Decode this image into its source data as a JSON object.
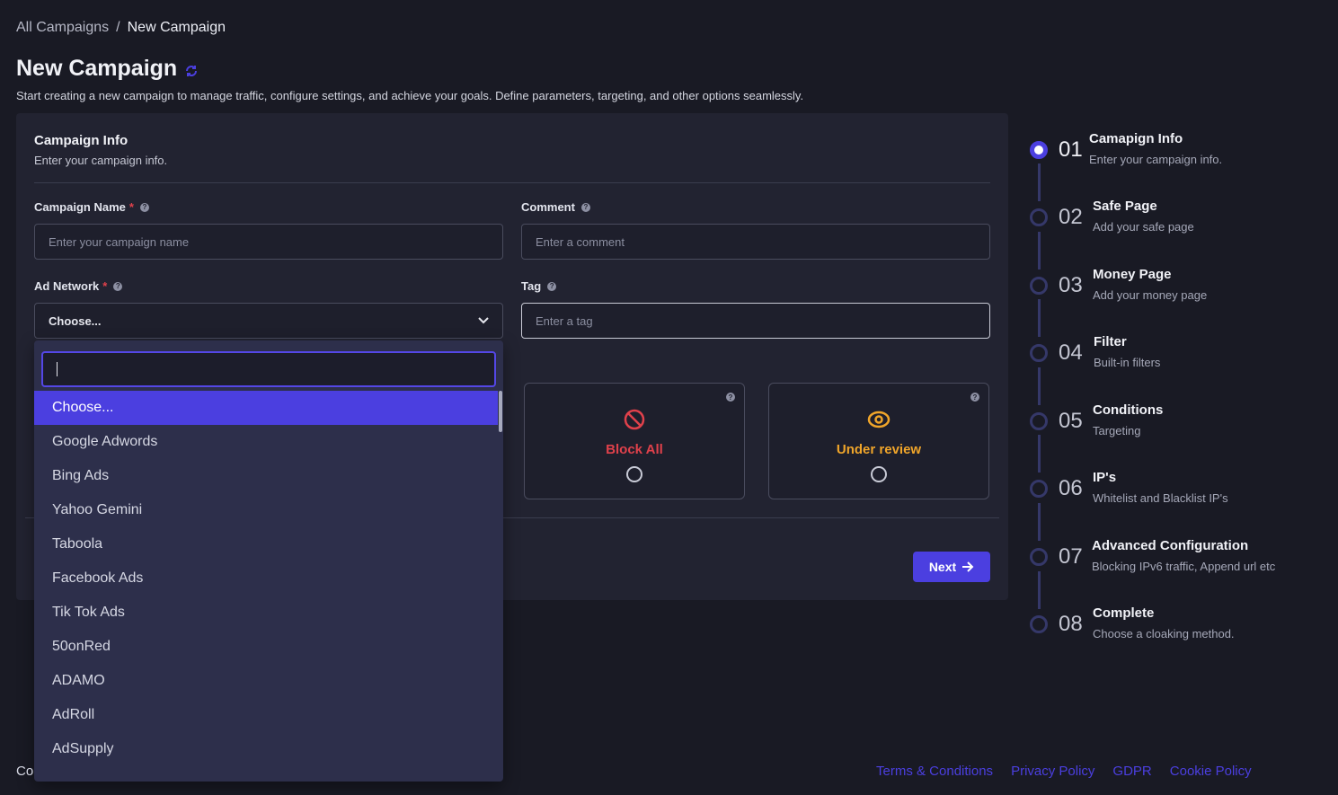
{
  "breadcrumb": {
    "parent": "All Campaigns",
    "separator": "/",
    "current": "New Campaign"
  },
  "page": {
    "title": "New Campaign",
    "subtitle": "Start creating a new campaign to manage traffic, configure settings, and achieve your goals. Define parameters, targeting, and other options seamlessly."
  },
  "card": {
    "section_title": "Campaign Info",
    "section_sub": "Enter your campaign info.",
    "campaign_name_label": "Campaign Name",
    "campaign_name_placeholder": "Enter your campaign name",
    "comment_label": "Comment",
    "comment_placeholder": "Enter a comment",
    "ad_network_label": "Ad Network",
    "ad_network_value": "Choose...",
    "tag_label": "Tag",
    "tag_placeholder": "Enter a tag",
    "required_mark": "*",
    "options": [
      {
        "label": "Block All",
        "color": "#e0414b",
        "icon": "block-icon"
      },
      {
        "label": "Under review",
        "color": "#f0a52a",
        "icon": "eye-icon"
      }
    ],
    "next_label": "Next"
  },
  "dropdown": {
    "search_value": "",
    "items": [
      "Choose...",
      "Google Adwords",
      "Bing Ads",
      "Yahoo Gemini",
      "Taboola",
      "Facebook Ads",
      "Tik Tok Ads",
      "50onRed",
      "ADAMO",
      "AdRoll",
      "AdSupply"
    ]
  },
  "steps": [
    {
      "num": "01",
      "title": "Camapign Info",
      "sub": "Enter your campaign info.",
      "active": true
    },
    {
      "num": "02",
      "title": "Safe Page",
      "sub": "Add your safe page"
    },
    {
      "num": "03",
      "title": "Money Page",
      "sub": "Add your money page"
    },
    {
      "num": "04",
      "title": "Filter",
      "sub": "Built-in filters"
    },
    {
      "num": "05",
      "title": "Conditions",
      "sub": "Targeting"
    },
    {
      "num": "06",
      "title": "IP's",
      "sub": "Whitelist and Blacklist IP's"
    },
    {
      "num": "07",
      "title": "Advanced Configuration",
      "sub": "Blocking IPv6 traffic, Append url etc"
    },
    {
      "num": "08",
      "title": "Complete",
      "sub": "Choose a cloaking method."
    }
  ],
  "footer": {
    "left": "Co",
    "links": [
      "Terms & Conditions",
      "Privacy Policy",
      "GDPR",
      "Cookie Policy"
    ]
  },
  "colors": {
    "accent": "#4b3fe0",
    "danger": "#e0414b",
    "warning": "#f0a52a",
    "background": "#191a24",
    "card": "#222331"
  }
}
